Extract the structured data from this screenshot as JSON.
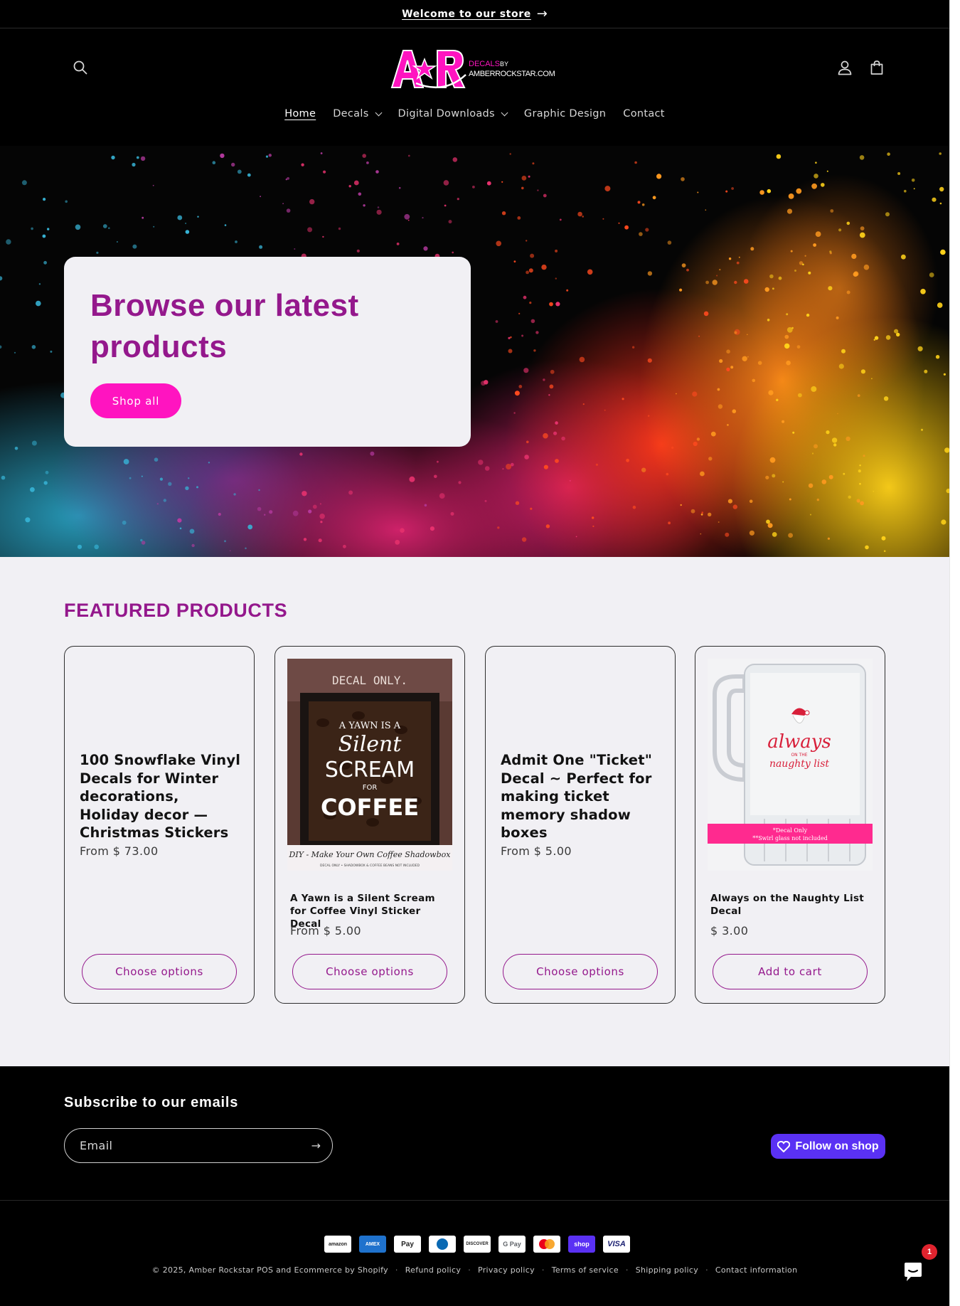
{
  "announcement": {
    "text": "Welcome to our store",
    "arrow": "→"
  },
  "header": {
    "logo": {
      "mark": "A★R",
      "line1": "DECALS BY",
      "line2": "AMBERROCKSTAR.COM"
    },
    "icons": {
      "search": "search-icon",
      "account": "account-icon",
      "cart": "cart-icon"
    },
    "nav": [
      {
        "label": "Home",
        "active": true,
        "dropdown": false
      },
      {
        "label": "Decals",
        "active": false,
        "dropdown": true
      },
      {
        "label": "Digital Downloads",
        "active": false,
        "dropdown": true
      },
      {
        "label": "Graphic Design",
        "active": false,
        "dropdown": false
      },
      {
        "label": "Contact",
        "active": false,
        "dropdown": false
      }
    ]
  },
  "hero": {
    "title": "Browse our latest products",
    "button": "Shop all"
  },
  "featured": {
    "title": "FEATURED PRODUCTS",
    "products": [
      {
        "title": "100 Snowflake Vinyl Decals for Winter decorations, Holiday decor — Christmas Stickers",
        "price": "From $ 73.00",
        "button": "Choose options",
        "has_image": false
      },
      {
        "title": "A Yawn is a Silent Scream for Coffee Vinyl Sticker Decal",
        "price": "From $ 5.00",
        "button": "Choose options",
        "has_image": true,
        "image_text": {
          "top": "DECAL ONLY.",
          "l1": "A YAWN IS A",
          "l2": "Silent",
          "l3": "SCREAM",
          "l4": "FOR",
          "l5": "COFFEE",
          "strip": "DIY - Make Your Own Coffee Shadowbox",
          "small": "DECAL ONLY • SHADOWBOX & COFFEE BEANS NOT INCLUDED"
        }
      },
      {
        "title": "Admit One \"Ticket\" Decal ~ Perfect for making ticket memory shadow boxes",
        "price": "From $ 5.00",
        "button": "Choose options",
        "has_image": false
      },
      {
        "title": "Always on the Naughty List Decal",
        "price": "$ 3.00",
        "button": "Add to cart",
        "has_image": true,
        "image_text": {
          "main": "always",
          "sub1": "ON THE",
          "sub2": "naughty list",
          "band1": "*Decal Only",
          "band2": "**Swirl glass not included"
        }
      }
    ]
  },
  "footer": {
    "subscribe_title": "Subscribe to our emails",
    "email_placeholder": "Email",
    "follow_button": "Follow on shop",
    "payments": [
      "amazon",
      "AMEX",
      "Pay",
      "Diners",
      "DISCOVER",
      "G Pay",
      "mastercard",
      "shop",
      "VISA"
    ],
    "copyright": "© 2025, Amber Rockstar POS and Ecommerce by Shopify",
    "links": [
      "Refund policy",
      "Privacy policy",
      "Terms of service",
      "Shipping policy",
      "Contact information"
    ],
    "chat_badge": "1"
  },
  "colors": {
    "brand_purple": "#94188c",
    "brand_pink": "#ff14c0",
    "shop_purple": "#5a31f4",
    "background": "#f1f0f4"
  }
}
